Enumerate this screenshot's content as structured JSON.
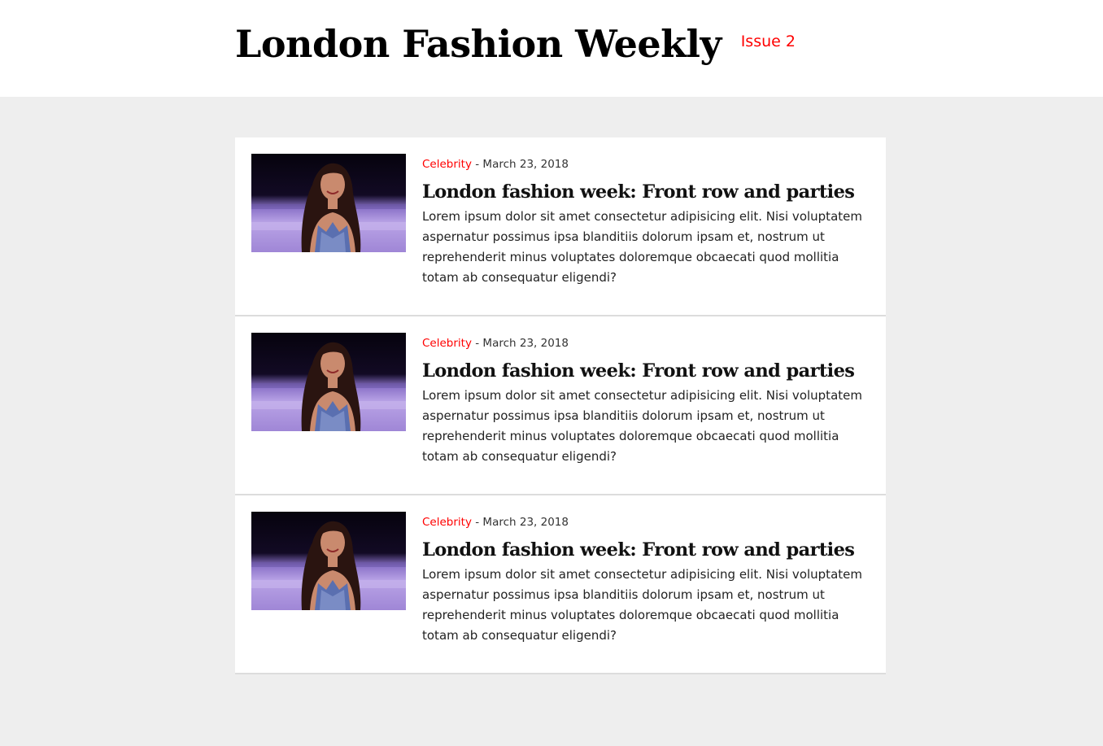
{
  "header": {
    "title": "London Fashion Weekly",
    "issue": "Issue 2"
  },
  "articles": [
    {
      "category": "Celebrity",
      "separator": " - ",
      "date": "March 23, 2018",
      "headline": "London fashion week: Front row and parties",
      "excerpt": "Lorem ipsum dolor sit amet consectetur adipisicing elit. Nisi voluptatem aspernatur possimus ipsa blanditiis dolorum ipsam et, nostrum ut reprehenderit minus voluptates doloremque obcaecati quod mollitia totam ab consequatur eligendi?"
    },
    {
      "category": "Celebrity",
      "separator": " - ",
      "date": "March 23, 2018",
      "headline": "London fashion week: Front row and parties",
      "excerpt": "Lorem ipsum dolor sit amet consectetur adipisicing elit. Nisi voluptatem aspernatur possimus ipsa blanditiis dolorum ipsam et, nostrum ut reprehenderit minus voluptates doloremque obcaecati quod mollitia totam ab consequatur eligendi?"
    },
    {
      "category": "Celebrity",
      "separator": " - ",
      "date": "March 23, 2018",
      "headline": "London fashion week: Front row and parties",
      "excerpt": "Lorem ipsum dolor sit amet consectetur adipisicing elit. Nisi voluptatem aspernatur possimus ipsa blanditiis dolorum ipsam et, nostrum ut reprehenderit minus voluptates doloremque obcaecati quod mollitia totam ab consequatur eligendi?"
    }
  ],
  "colors": {
    "accent": "#ff0000",
    "page_background": "#eeeeee",
    "card_background": "#ffffff"
  }
}
